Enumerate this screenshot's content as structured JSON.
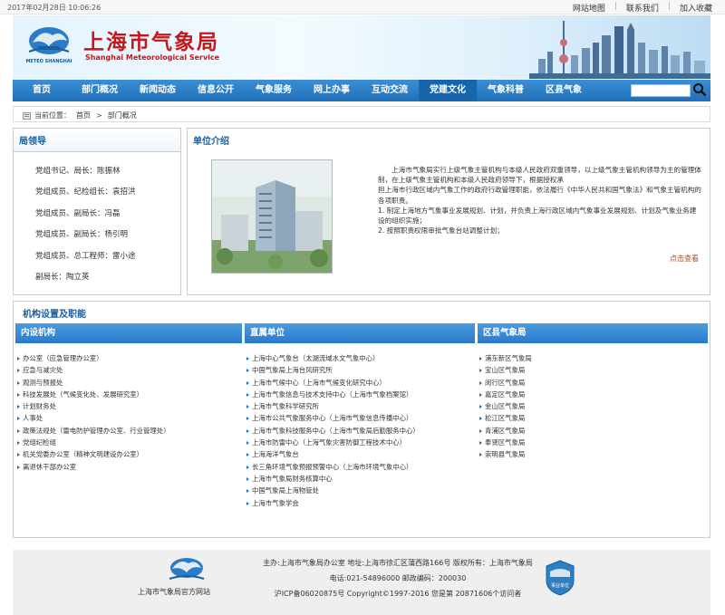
{
  "topbar": {
    "datetime": "2017年02月28日  10:06:26",
    "links": [
      "网站地图",
      "联系我们",
      "加入收藏"
    ],
    "separator": "|"
  },
  "header": {
    "title_cn": "上海市气象局",
    "title_en": "Shanghai Meteorological Service",
    "logo_text": "METEO SHANGHAI"
  },
  "nav": {
    "items": [
      "首页",
      "部门概况",
      "新闻动态",
      "信息公开",
      "气象服务",
      "网上办事",
      "互动交流",
      "党建文化",
      "气象科普",
      "区县气象"
    ],
    "active_index": 7,
    "search_placeholder": ""
  },
  "breadcrumb": {
    "prefix": "当前位置：",
    "items": [
      "首页",
      "部门概况"
    ],
    "separator": ">"
  },
  "leaders": {
    "title": "局领导",
    "items": [
      "党组书记、局长：陈振林",
      "党组成员、纪检组长：袁招洪",
      "党组成员、副局长：冯磊",
      "党组成员、副局长：杨引明",
      "党组成员、总工程师：雷小途",
      "副局长：陶立英"
    ]
  },
  "intro": {
    "title": "单位介绍",
    "paragraphs": [
      "　　上海市气象局实行上级气象主管机构与本级人民政府双重领导，以上级气象主管机构领导为主的管理体制，在上级气象主管机构和本级人民政府领导下，根据授权承",
      "担上海市行政区域内气象工作的政府行政管理职能，依法履行《中华人民共和国气象法》和气象主管机构的各项职责。",
      "1. 制定上海地方气象事业发展规划、计划，并负责上海行政区域内气象事业发展规划、计划及气象业务建设的组织实施；",
      "2. 按照职责权限审批气象台站调整计划；"
    ],
    "more_label": "点击查看"
  },
  "org": {
    "title": "机构设置及职能",
    "columns": [
      {
        "title": "内设机构",
        "items": [
          "办公室（应急管理办公室）",
          "应急与减灾处",
          "观测与预报处",
          "科技发展处（气候变化处、发展研究室）",
          "计划财务处",
          "人事处",
          "政策法规处（雷电防护管理办公室、行业管理处）",
          "党组纪检组",
          "机关党委办公室（精神文明建设办公室）",
          "离退休干部办公室"
        ]
      },
      {
        "title": "直属单位",
        "items": [
          "上海中心气象台（太湖流域水文气象中心）",
          "中国气象局上海台风研究所",
          "上海市气候中心（上海市气候变化研究中心）",
          "上海市气象信息与技术支持中心（上海市气象档案馆）",
          "上海市气象科学研究所",
          "上海市公共气象服务中心（上海市气象信息传播中心）",
          "上海市气象科技服务中心（上海市气象局后勤服务中心）",
          "上海市防雷中心（上海气象灾害防御工程技术中心）",
          "上海海洋气象台",
          "长三角环境气象预报预警中心（上海市环境气象中心）",
          "上海市气象局财务核算中心",
          "中国气象局上海物管处",
          "上海市气象学会"
        ]
      },
      {
        "title": "区县气象局",
        "items": [
          "浦东新区气象局",
          "宝山区气象局",
          "闵行区气象局",
          "嘉定区气象局",
          "金山区气象局",
          "松江区气象局",
          "青浦区气象局",
          "奉贤区气象局",
          "崇明县气象局"
        ]
      }
    ]
  },
  "footer": {
    "site_name": "上海市气象局官方网站",
    "lines": [
      "主办:上海市气象局办公室 地址:上海市徐汇区蒲西路166号 版权所有：上海市气象局",
      "电话:021-54896000 邮政编码：200030",
      "沪ICP备06020875号 Copyright©1997-2016  您是第 20871606个访问者"
    ],
    "badge_text": "事业单位"
  },
  "colors": {
    "brand_red": "#c4171c",
    "nav_blue": "#1e6fb9",
    "heading_blue": "#1a5ea0"
  }
}
